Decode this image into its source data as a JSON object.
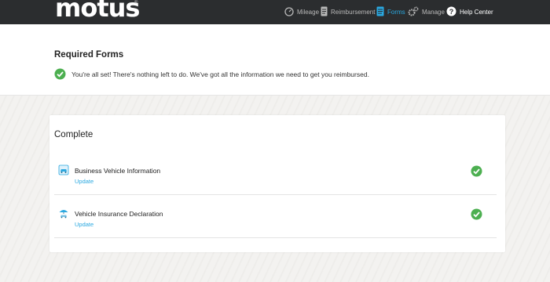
{
  "brand": {
    "logo": "motus",
    "trademark": "®"
  },
  "nav": {
    "mileage": "Mileage",
    "reimbursement": "Reimbursement",
    "forms": "Forms",
    "manage": "Manage",
    "help": "Help Center"
  },
  "required": {
    "title": "Required Forms",
    "message": "You're all set! There's nothing left to do. We've got all the information we need to get you reimbursed."
  },
  "complete": {
    "title": "Complete",
    "items": [
      {
        "name": "Business Vehicle Information",
        "action": "Update",
        "icon": "car-icon",
        "status": "complete"
      },
      {
        "name": "Vehicle Insurance Declaration",
        "action": "Update",
        "icon": "umbrella-car-icon",
        "status": "complete"
      }
    ]
  },
  "colors": {
    "accent": "#2aa8e0",
    "success": "#4caf50",
    "navbar": "#2b2d2f"
  }
}
